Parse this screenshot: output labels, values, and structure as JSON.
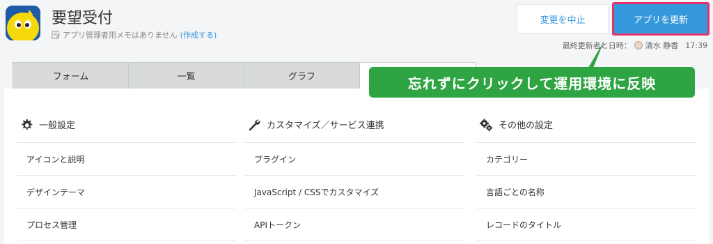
{
  "header": {
    "title": "要望受付",
    "memo_text": "アプリ管理者用メモはありません",
    "memo_link": "(作成する)",
    "cancel_label": "変更を中止",
    "update_label": "アプリを更新",
    "last_updated_label": "最終更新者と日時：",
    "last_updated_user": "清水 静香",
    "last_updated_time": "17:39"
  },
  "tabs": [
    {
      "label": "フォーム"
    },
    {
      "label": "一覧"
    },
    {
      "label": "グラフ"
    },
    {
      "label": ""
    }
  ],
  "callout": {
    "text": "忘れずにクリックして運用環境に反映"
  },
  "sections": [
    {
      "title": "一般設定",
      "icon": "gear-icon",
      "items": [
        "アイコンと説明",
        "デザインテーマ",
        "プロセス管理"
      ]
    },
    {
      "title": "カスタマイズ／サービス連携",
      "icon": "wrench-icon",
      "items": [
        "プラグイン",
        "JavaScript / CSSでカスタマイズ",
        "APIトークン"
      ]
    },
    {
      "title": "その他の設定",
      "icon": "gears-icon",
      "items": [
        "カテゴリー",
        "言語ごとの名称",
        "レコードのタイトル"
      ]
    }
  ],
  "colors": {
    "accent": "#3498db",
    "highlight_border": "#e6346a",
    "callout": "#2ea443"
  }
}
